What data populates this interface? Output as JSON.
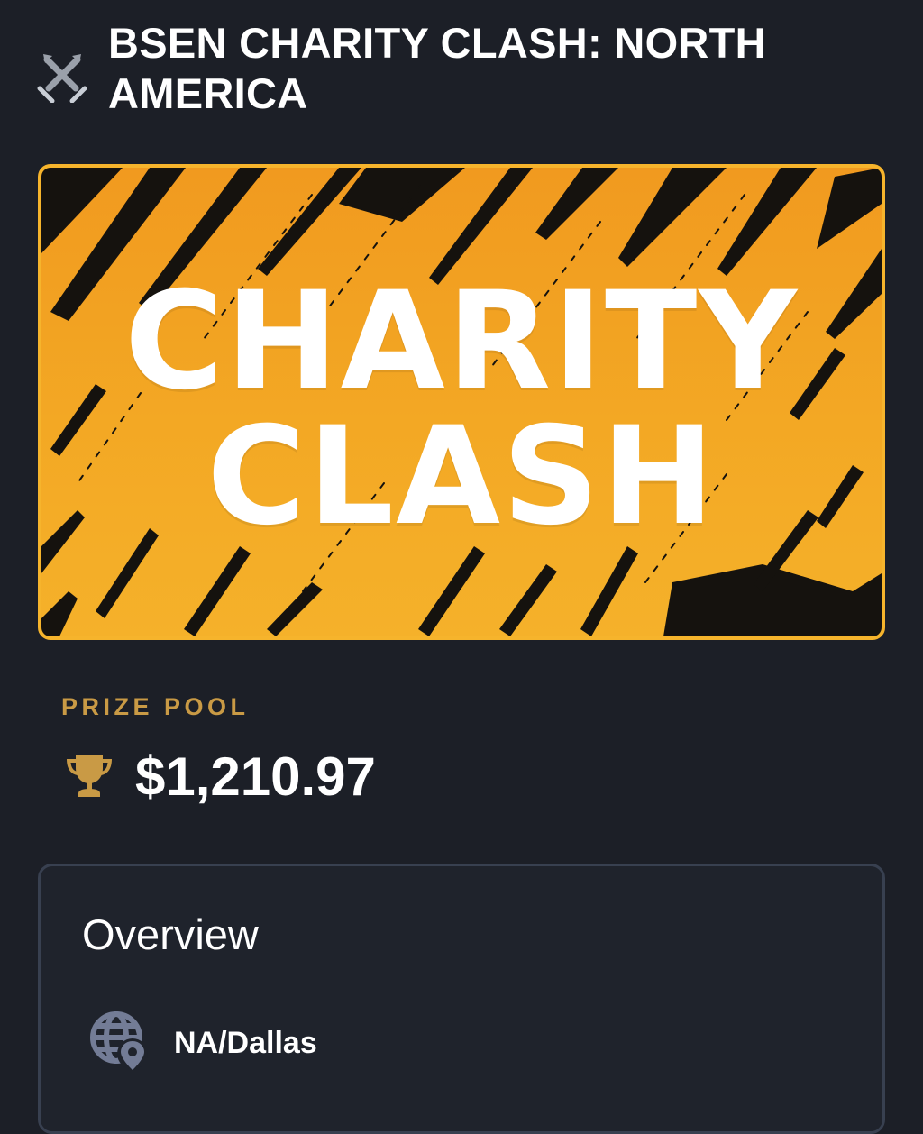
{
  "header": {
    "title": "BSEN CHARITY CLASH: NORTH AMERICA",
    "game_icon": "crossed-swords-icon"
  },
  "banner": {
    "line1": "CHARITY",
    "line2": "CLASH",
    "colors": {
      "background": "#f3a824",
      "border": "#f6b42c",
      "strokes": "#111111",
      "text": "#ffffff"
    }
  },
  "prize": {
    "label": "PRIZE POOL",
    "amount": "$1,210.97",
    "icon": "trophy-icon",
    "accent": "#c99a45"
  },
  "overview": {
    "title": "Overview",
    "location": {
      "icon": "globe-location-icon",
      "text": "NA/Dallas"
    }
  },
  "theme": {
    "page_background": "#1c1f27",
    "card_border": "#384050"
  }
}
